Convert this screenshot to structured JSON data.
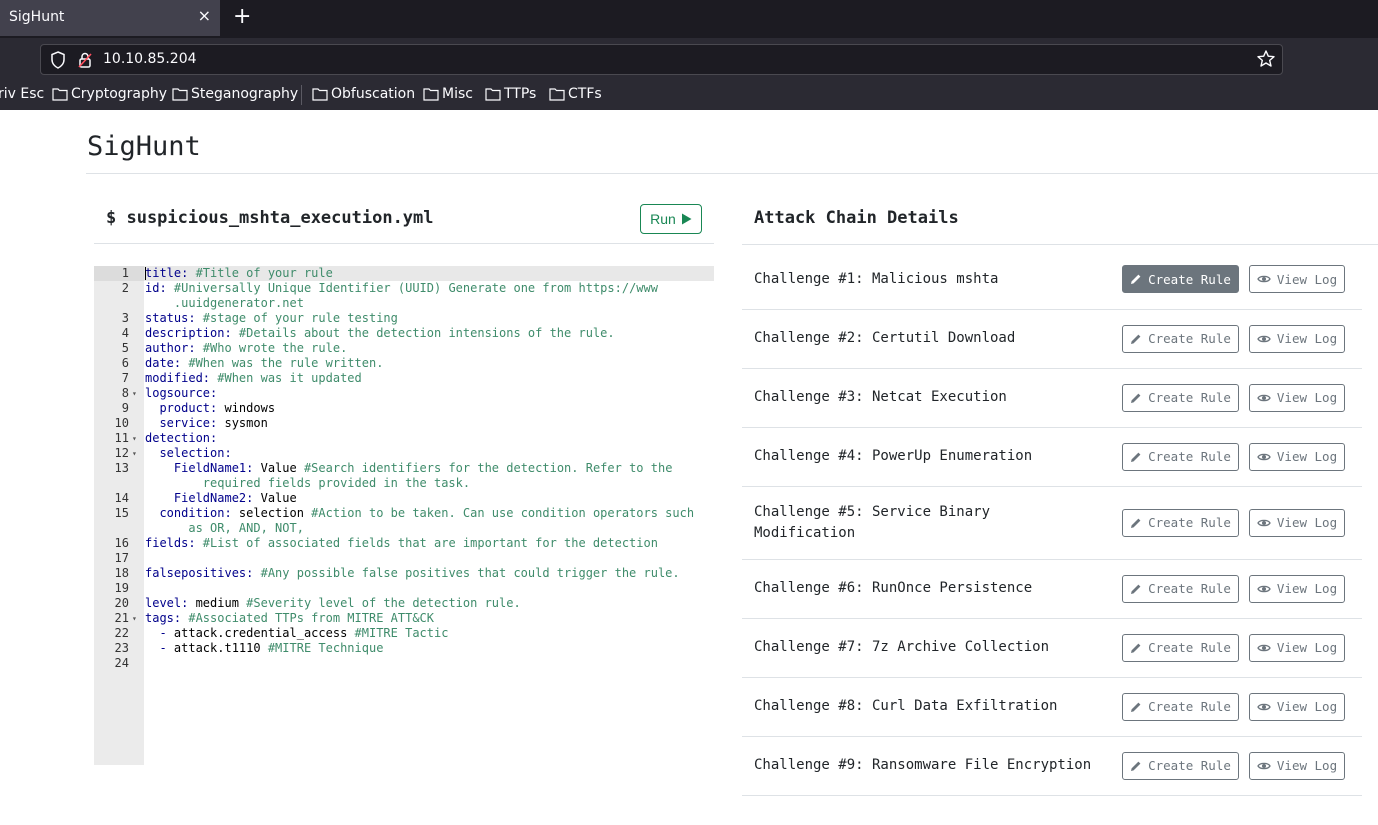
{
  "browser": {
    "tab_title": "SigHunt",
    "tab_close": "×",
    "new_tab": "+",
    "url": "10.10.85.204",
    "bookmarks": [
      "riv Esc",
      "Cryptography",
      "Steganography",
      "Obfuscation",
      "Misc",
      "TTPs",
      "CTFs"
    ]
  },
  "page": {
    "title": "SigHunt"
  },
  "editor": {
    "filename": "$ suspicious_mshta_execution.yml",
    "run_label": "Run"
  },
  "code_lines": [
    {
      "n": "1",
      "key": "title:",
      "val": "",
      "comment": " #Title of your rule"
    },
    {
      "n": "2",
      "key": "id:",
      "val": "",
      "comment": " #Universally Unique Identifier (UUID) Generate one from https://www"
    },
    {
      "n": "",
      "key": "",
      "val": "",
      "comment": "    .uuidgenerator.net"
    },
    {
      "n": "3",
      "key": "status:",
      "val": "",
      "comment": " #stage of your rule testing"
    },
    {
      "n": "4",
      "key": "description:",
      "val": "",
      "comment": " #Details about the detection intensions of the rule."
    },
    {
      "n": "5",
      "key": "author:",
      "val": "",
      "comment": " #Who wrote the rule."
    },
    {
      "n": "6",
      "key": "date:",
      "val": "",
      "comment": " #When was the rule written."
    },
    {
      "n": "7",
      "key": "modified:",
      "val": "",
      "comment": " #When was it updated"
    },
    {
      "n": "8",
      "key": "logsource:",
      "val": "",
      "comment": ""
    },
    {
      "n": "9",
      "key": "  product:",
      "val": " windows",
      "comment": ""
    },
    {
      "n": "10",
      "key": "  service:",
      "val": " sysmon",
      "comment": ""
    },
    {
      "n": "11",
      "key": "detection:",
      "val": "",
      "comment": ""
    },
    {
      "n": "12",
      "key": "  selection:",
      "val": "",
      "comment": ""
    },
    {
      "n": "13",
      "key": "    FieldName1:",
      "val": " Value",
      "comment": " #Search identifiers for the detection. Refer to the"
    },
    {
      "n": "",
      "key": "",
      "val": "",
      "comment": "        required fields provided in the task."
    },
    {
      "n": "14",
      "key": "    FieldName2:",
      "val": " Value",
      "comment": ""
    },
    {
      "n": "15",
      "key": "  condition:",
      "val": " selection",
      "comment": " #Action to be taken. Can use condition operators such"
    },
    {
      "n": "",
      "key": "",
      "val": "",
      "comment": "      as OR, AND, NOT,"
    },
    {
      "n": "16",
      "key": "fields:",
      "val": "",
      "comment": " #List of associated fields that are important for the detection"
    },
    {
      "n": "17",
      "key": "",
      "val": "",
      "comment": ""
    },
    {
      "n": "18",
      "key": "falsepositives:",
      "val": "",
      "comment": " #Any possible false positives that could trigger the rule."
    },
    {
      "n": "19",
      "key": "",
      "val": "",
      "comment": ""
    },
    {
      "n": "20",
      "key": "level:",
      "val": " medium",
      "comment": " #Severity level of the detection rule."
    },
    {
      "n": "21",
      "key": "tags:",
      "val": "",
      "comment": " #Associated TTPs from MITRE ATT&CK"
    },
    {
      "n": "22",
      "key": "  - ",
      "val": "attack.credential_access",
      "comment": " #MITRE Tactic"
    },
    {
      "n": "23",
      "key": "  - ",
      "val": "attack.t1110",
      "comment": " #MITRE Technique"
    },
    {
      "n": "24",
      "key": "",
      "val": "",
      "comment": ""
    }
  ],
  "fold_lines": [
    "8",
    "11",
    "12",
    "21"
  ],
  "details": {
    "title": "Attack Chain Details",
    "create_label": "Create Rule",
    "view_label": "View Log",
    "challenges": [
      {
        "label": "Challenge #1: Malicious mshta",
        "active": true
      },
      {
        "label": "Challenge #2: Certutil Download",
        "active": false
      },
      {
        "label": "Challenge #3: Netcat Execution",
        "active": false
      },
      {
        "label": "Challenge #4: PowerUp Enumeration",
        "active": false
      },
      {
        "label": "Challenge #5: Service Binary Modification",
        "active": false
      },
      {
        "label": "Challenge #6: RunOnce Persistence",
        "active": false
      },
      {
        "label": "Challenge #7: 7z Archive Collection",
        "active": false
      },
      {
        "label": "Challenge #8: Curl Data Exfiltration",
        "active": false
      },
      {
        "label": "Challenge #9: Ransomware File Encryption",
        "active": false
      }
    ]
  },
  "colors": {
    "run_green": "#198754",
    "secondary": "#6c757d",
    "comment": "#3f8c6b",
    "key": "#00008b"
  }
}
